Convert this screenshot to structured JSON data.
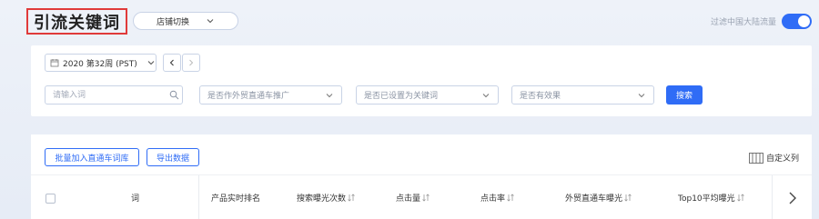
{
  "header": {
    "title": "引流关键词",
    "store_switch_label": "店铺切换",
    "filter_label": "过滤中国大陆流量"
  },
  "filters": {
    "week_label": "2020 第32周 (PST)",
    "search_placeholder": "请输入词",
    "dropdowns": [
      {
        "label": "是否作外贸直通车推广"
      },
      {
        "label": "是否已设置为关键词"
      },
      {
        "label": "是否有效果"
      }
    ],
    "search_button": "搜索"
  },
  "toolbar": {
    "batch_add_label": "批量加入直通车词库",
    "export_label": "导出数据",
    "custom_columns_label": "自定义列"
  },
  "table": {
    "headers": [
      "词",
      "产品实时排名",
      "搜索曝光次数",
      "点击量",
      "点击率",
      "外贸直通车曝光",
      "Top10平均曝光"
    ]
  },
  "colors": {
    "accent": "#2f6cf6",
    "highlight_border": "#e03a3a"
  }
}
